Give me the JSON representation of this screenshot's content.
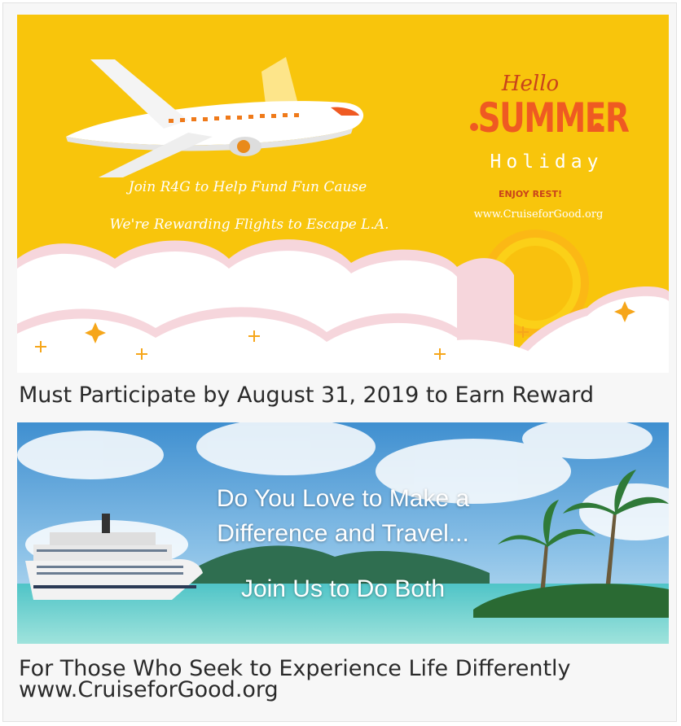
{
  "banner_summer": {
    "join_text": "Join R4G to Help Fund Fun Cause",
    "reward_text": "We're Rewarding Flights to Escape L.A.",
    "hello": "Hello",
    "summer": "SUMMER",
    "holiday": "Holiday",
    "enjoy": "ENJOY REST!",
    "website": "www.CruiseforGood.org",
    "colors": {
      "background": "#f8c50c",
      "accent": "#ef5a22",
      "cloud": "#ffffff"
    }
  },
  "caption_deadline": "Must Participate by August  31, 2019 to Earn Reward",
  "banner_cruise": {
    "line1": "Do You Love to Make a",
    "line2": "Difference and Travel...",
    "line3": "Join Us to Do Both"
  },
  "caption_tagline": "For Those Who Seek to Experience Life Differently",
  "caption_website": "www.CruiseforGood.org"
}
